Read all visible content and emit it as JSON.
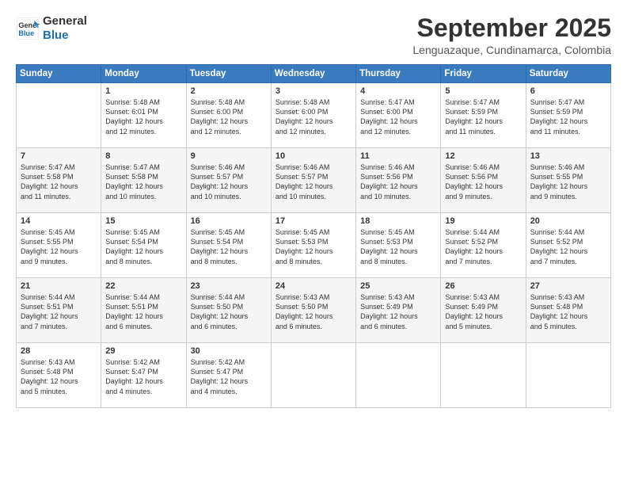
{
  "header": {
    "logo_line1": "General",
    "logo_line2": "Blue",
    "title": "September 2025",
    "subtitle": "Lenguazaque, Cundinamarca, Colombia"
  },
  "columns": [
    "Sunday",
    "Monday",
    "Tuesday",
    "Wednesday",
    "Thursday",
    "Friday",
    "Saturday"
  ],
  "weeks": [
    [
      {
        "day": "",
        "text": ""
      },
      {
        "day": "1",
        "text": "Sunrise: 5:48 AM\nSunset: 6:01 PM\nDaylight: 12 hours\nand 12 minutes."
      },
      {
        "day": "2",
        "text": "Sunrise: 5:48 AM\nSunset: 6:00 PM\nDaylight: 12 hours\nand 12 minutes."
      },
      {
        "day": "3",
        "text": "Sunrise: 5:48 AM\nSunset: 6:00 PM\nDaylight: 12 hours\nand 12 minutes."
      },
      {
        "day": "4",
        "text": "Sunrise: 5:47 AM\nSunset: 6:00 PM\nDaylight: 12 hours\nand 12 minutes."
      },
      {
        "day": "5",
        "text": "Sunrise: 5:47 AM\nSunset: 5:59 PM\nDaylight: 12 hours\nand 11 minutes."
      },
      {
        "day": "6",
        "text": "Sunrise: 5:47 AM\nSunset: 5:59 PM\nDaylight: 12 hours\nand 11 minutes."
      }
    ],
    [
      {
        "day": "7",
        "text": "Sunrise: 5:47 AM\nSunset: 5:58 PM\nDaylight: 12 hours\nand 11 minutes."
      },
      {
        "day": "8",
        "text": "Sunrise: 5:47 AM\nSunset: 5:58 PM\nDaylight: 12 hours\nand 10 minutes."
      },
      {
        "day": "9",
        "text": "Sunrise: 5:46 AM\nSunset: 5:57 PM\nDaylight: 12 hours\nand 10 minutes."
      },
      {
        "day": "10",
        "text": "Sunrise: 5:46 AM\nSunset: 5:57 PM\nDaylight: 12 hours\nand 10 minutes."
      },
      {
        "day": "11",
        "text": "Sunrise: 5:46 AM\nSunset: 5:56 PM\nDaylight: 12 hours\nand 10 minutes."
      },
      {
        "day": "12",
        "text": "Sunrise: 5:46 AM\nSunset: 5:56 PM\nDaylight: 12 hours\nand 9 minutes."
      },
      {
        "day": "13",
        "text": "Sunrise: 5:46 AM\nSunset: 5:55 PM\nDaylight: 12 hours\nand 9 minutes."
      }
    ],
    [
      {
        "day": "14",
        "text": "Sunrise: 5:45 AM\nSunset: 5:55 PM\nDaylight: 12 hours\nand 9 minutes."
      },
      {
        "day": "15",
        "text": "Sunrise: 5:45 AM\nSunset: 5:54 PM\nDaylight: 12 hours\nand 8 minutes."
      },
      {
        "day": "16",
        "text": "Sunrise: 5:45 AM\nSunset: 5:54 PM\nDaylight: 12 hours\nand 8 minutes."
      },
      {
        "day": "17",
        "text": "Sunrise: 5:45 AM\nSunset: 5:53 PM\nDaylight: 12 hours\nand 8 minutes."
      },
      {
        "day": "18",
        "text": "Sunrise: 5:45 AM\nSunset: 5:53 PM\nDaylight: 12 hours\nand 8 minutes."
      },
      {
        "day": "19",
        "text": "Sunrise: 5:44 AM\nSunset: 5:52 PM\nDaylight: 12 hours\nand 7 minutes."
      },
      {
        "day": "20",
        "text": "Sunrise: 5:44 AM\nSunset: 5:52 PM\nDaylight: 12 hours\nand 7 minutes."
      }
    ],
    [
      {
        "day": "21",
        "text": "Sunrise: 5:44 AM\nSunset: 5:51 PM\nDaylight: 12 hours\nand 7 minutes."
      },
      {
        "day": "22",
        "text": "Sunrise: 5:44 AM\nSunset: 5:51 PM\nDaylight: 12 hours\nand 6 minutes."
      },
      {
        "day": "23",
        "text": "Sunrise: 5:44 AM\nSunset: 5:50 PM\nDaylight: 12 hours\nand 6 minutes."
      },
      {
        "day": "24",
        "text": "Sunrise: 5:43 AM\nSunset: 5:50 PM\nDaylight: 12 hours\nand 6 minutes."
      },
      {
        "day": "25",
        "text": "Sunrise: 5:43 AM\nSunset: 5:49 PM\nDaylight: 12 hours\nand 6 minutes."
      },
      {
        "day": "26",
        "text": "Sunrise: 5:43 AM\nSunset: 5:49 PM\nDaylight: 12 hours\nand 5 minutes."
      },
      {
        "day": "27",
        "text": "Sunrise: 5:43 AM\nSunset: 5:48 PM\nDaylight: 12 hours\nand 5 minutes."
      }
    ],
    [
      {
        "day": "28",
        "text": "Sunrise: 5:43 AM\nSunset: 5:48 PM\nDaylight: 12 hours\nand 5 minutes."
      },
      {
        "day": "29",
        "text": "Sunrise: 5:42 AM\nSunset: 5:47 PM\nDaylight: 12 hours\nand 4 minutes."
      },
      {
        "day": "30",
        "text": "Sunrise: 5:42 AM\nSunset: 5:47 PM\nDaylight: 12 hours\nand 4 minutes."
      },
      {
        "day": "",
        "text": ""
      },
      {
        "day": "",
        "text": ""
      },
      {
        "day": "",
        "text": ""
      },
      {
        "day": "",
        "text": ""
      }
    ]
  ]
}
